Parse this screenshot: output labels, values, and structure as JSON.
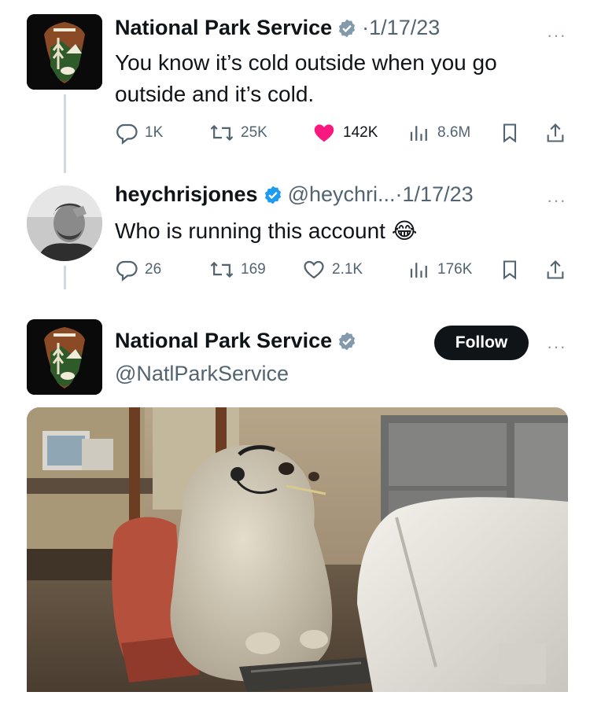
{
  "tweet1": {
    "author": "National Park Service",
    "date": "1/17/23",
    "text": "You know it’s cold outside when you go outside and it’s cold.",
    "stats": {
      "replies": "1K",
      "retweets": "25K",
      "likes": "142K",
      "views": "8.6M"
    },
    "liked": true
  },
  "tweet2": {
    "author": "heychrisjones",
    "handle": "@heychri...",
    "date": "1/17/23",
    "text": "Who is running this account",
    "emoji": "😂",
    "stats": {
      "replies": "26",
      "retweets": "169",
      "likes": "2.1K",
      "views": "176K"
    }
  },
  "profile": {
    "name": "National Park Service",
    "handle": "@NatlParkService",
    "follow_label": "Follow"
  },
  "common": {
    "separator": "·",
    "more": "···"
  },
  "colors": {
    "verified": "#829aab",
    "like": "#f91880",
    "follow_bg": "#0f1419"
  },
  "icons": [
    "verified-badge-icon",
    "reply-icon",
    "retweet-icon",
    "like-icon",
    "views-icon",
    "bookmark-icon",
    "share-icon",
    "more-icon"
  ]
}
